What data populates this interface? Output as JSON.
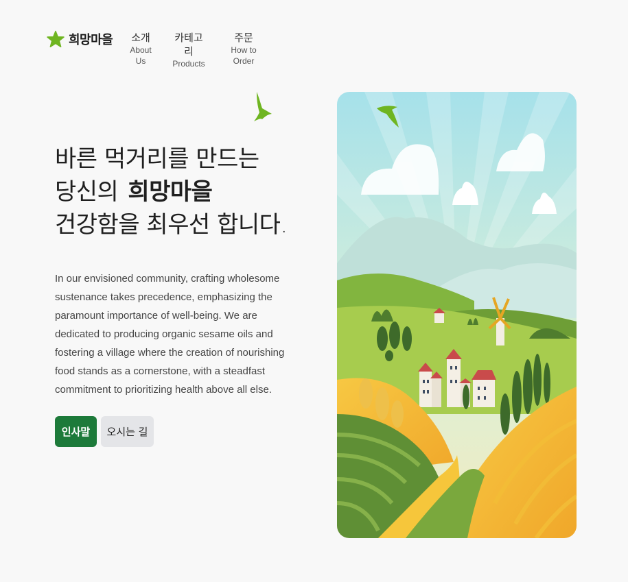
{
  "header": {
    "brand": "희망마을",
    "nav": [
      {
        "ko": "소개",
        "en": "About Us"
      },
      {
        "ko": "카테고리",
        "en": "Products"
      },
      {
        "ko": "주문",
        "en": "How to Order"
      }
    ]
  },
  "hero": {
    "headline_line1": "바른 먹거리를 만드는",
    "headline_line2_prefix": "당신의",
    "headline_line2_brand": "희망마을",
    "headline_line3": "건강함을 최우선 합니다.",
    "description": "In our envisioned community, crafting wholesome sustenance takes precedence, emphasizing the paramount importance of well-being. We are dedicated to producing organic sesame oils and fostering a village where the creation of nourishing food stands as a cornerstone, with a steadfast commitment to prioritizing health above all else.",
    "primary_button": "인사말",
    "secondary_button": "오시는 길"
  },
  "colors": {
    "brand_green": "#1d7a3a",
    "star_green": "#6fb521",
    "secondary_button_bg": "#e4e5e8"
  },
  "icons": {
    "logo": "star-icon",
    "decor": "bird-icon",
    "illustration": "village-landscape-illustration"
  }
}
